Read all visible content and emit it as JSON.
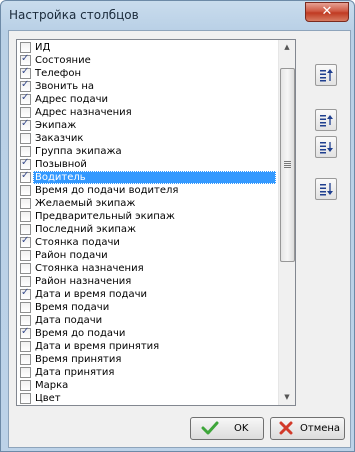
{
  "window": {
    "title": "Настройка столбцов",
    "close_glyph": "✕"
  },
  "columns": [
    {
      "label": "ИД",
      "checked": false
    },
    {
      "label": "Состояние",
      "checked": true
    },
    {
      "label": "Телефон",
      "checked": true
    },
    {
      "label": "Звонить на",
      "checked": true
    },
    {
      "label": "Адрес подачи",
      "checked": true
    },
    {
      "label": "Адрес назначения",
      "checked": false
    },
    {
      "label": "Экипаж",
      "checked": true
    },
    {
      "label": "Заказчик",
      "checked": false
    },
    {
      "label": "Группа экипажа",
      "checked": false
    },
    {
      "label": "Позывной",
      "checked": true
    },
    {
      "label": "Водитель",
      "checked": true,
      "selected": true
    },
    {
      "label": "Время до подачи водителя",
      "checked": false
    },
    {
      "label": "Желаемый экипаж",
      "checked": false
    },
    {
      "label": "Предварительный экипаж",
      "checked": false
    },
    {
      "label": "Последний экипаж",
      "checked": false
    },
    {
      "label": "Стоянка подачи",
      "checked": true
    },
    {
      "label": "Район подачи",
      "checked": false
    },
    {
      "label": "Стоянка назначения",
      "checked": false
    },
    {
      "label": "Район назначения",
      "checked": false
    },
    {
      "label": "Дата и время подачи",
      "checked": true
    },
    {
      "label": "Время подачи",
      "checked": false
    },
    {
      "label": "Дата подачи",
      "checked": false
    },
    {
      "label": "Время до подачи",
      "checked": true
    },
    {
      "label": "Дата и время принятия",
      "checked": false
    },
    {
      "label": "Время принятия",
      "checked": false
    },
    {
      "label": "Дата принятия",
      "checked": false
    },
    {
      "label": "Марка",
      "checked": false
    },
    {
      "label": "Цвет",
      "checked": false
    }
  ],
  "side_buttons": [
    {
      "name": "move-to-top-button",
      "icon": "move-top-icon"
    },
    {
      "name": "move-up-button",
      "icon": "move-up-icon"
    },
    {
      "name": "move-down-button",
      "icon": "move-down-icon"
    },
    {
      "name": "move-to-bottom-button",
      "icon": "move-bottom-icon"
    }
  ],
  "buttons": {
    "ok_label": "OK",
    "cancel_label": "Отмена"
  }
}
